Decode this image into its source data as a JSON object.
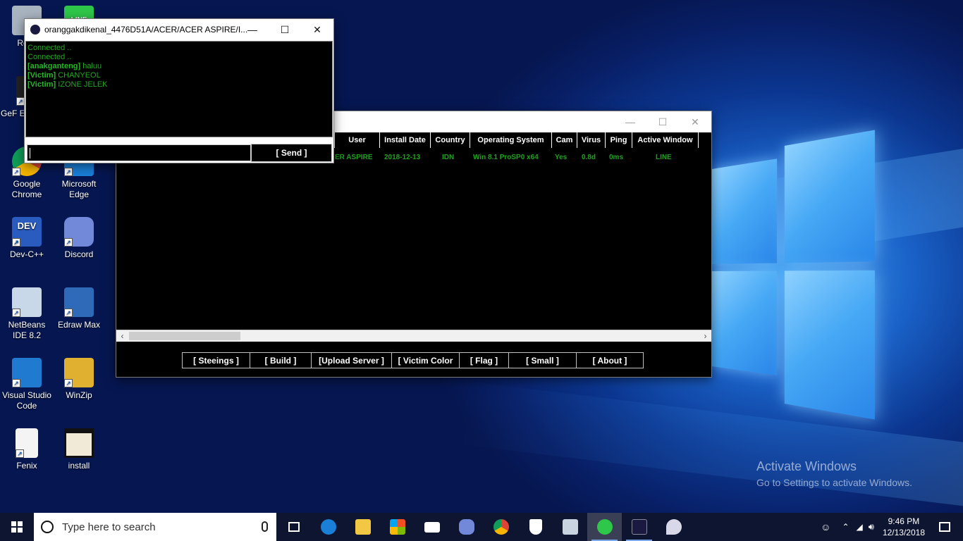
{
  "desktop": {
    "icons": [
      {
        "label": "Recy",
        "color": "#a8b4c0"
      },
      {
        "label": "LINE",
        "color": "#2ec74a"
      },
      {
        "label": "GeF Expe",
        "color": "#222"
      },
      {
        "label": "Google Chrome",
        "color": "#e0e0e0"
      },
      {
        "label": "Microsoft Edge",
        "color": "#1a7fd6"
      },
      {
        "label": "Dev-C++",
        "color": "#2a5cc0"
      },
      {
        "label": "Discord",
        "color": "#7289da"
      },
      {
        "label": "NetBeans IDE 8.2",
        "color": "#c8d8e8"
      },
      {
        "label": "Edraw Max",
        "color": "#2e6ab8"
      },
      {
        "label": "Visual Studio Code",
        "color": "#1f7ad0"
      },
      {
        "label": "WinZip",
        "color": "#e0b030"
      },
      {
        "label": "Fenix",
        "color": "#f4f4f4"
      },
      {
        "label": "install",
        "color": "#f0ead6"
      }
    ],
    "activate_title": "Activate Windows",
    "activate_sub": "Go to Settings to activate Windows."
  },
  "chat": {
    "title": "oranggakdikenal_4476D51A/ACER/ACER ASPIRE/I...",
    "lines": [
      {
        "tag": "",
        "text": "Connected .."
      },
      {
        "tag": "",
        "text": "Connected .."
      },
      {
        "tag": "[anakganteng]",
        "text": " haluu"
      },
      {
        "tag": "[Victim]",
        "text": " CHANYEOL"
      },
      {
        "tag": "[Victim]",
        "text": " IZONE JELEK"
      }
    ],
    "send_label": "[ Send ]"
  },
  "main": {
    "columns": [
      "User",
      "Install Date",
      "Country",
      "Operating System",
      "Cam",
      "Virus",
      "Ping",
      "Active Window"
    ],
    "row": [
      "ER ASPIRE",
      "2018-12-13",
      "IDN",
      "Win 8.1 ProSP0 x64",
      "Yes",
      "0.8d",
      "0ms",
      "LINE"
    ],
    "buttons": [
      "[  Steeings  ]",
      "[  Build  ]",
      "[Upload Server ]",
      "[ Victim Color",
      "[ Flag  ]",
      "[ Small  ]",
      "[ About ]"
    ]
  },
  "taskbar": {
    "search_placeholder": "Type here to search",
    "time": "9:46 PM",
    "date": "12/13/2018"
  },
  "colors": {
    "green_text": "#23a823",
    "taskbar": "#0d1530"
  }
}
